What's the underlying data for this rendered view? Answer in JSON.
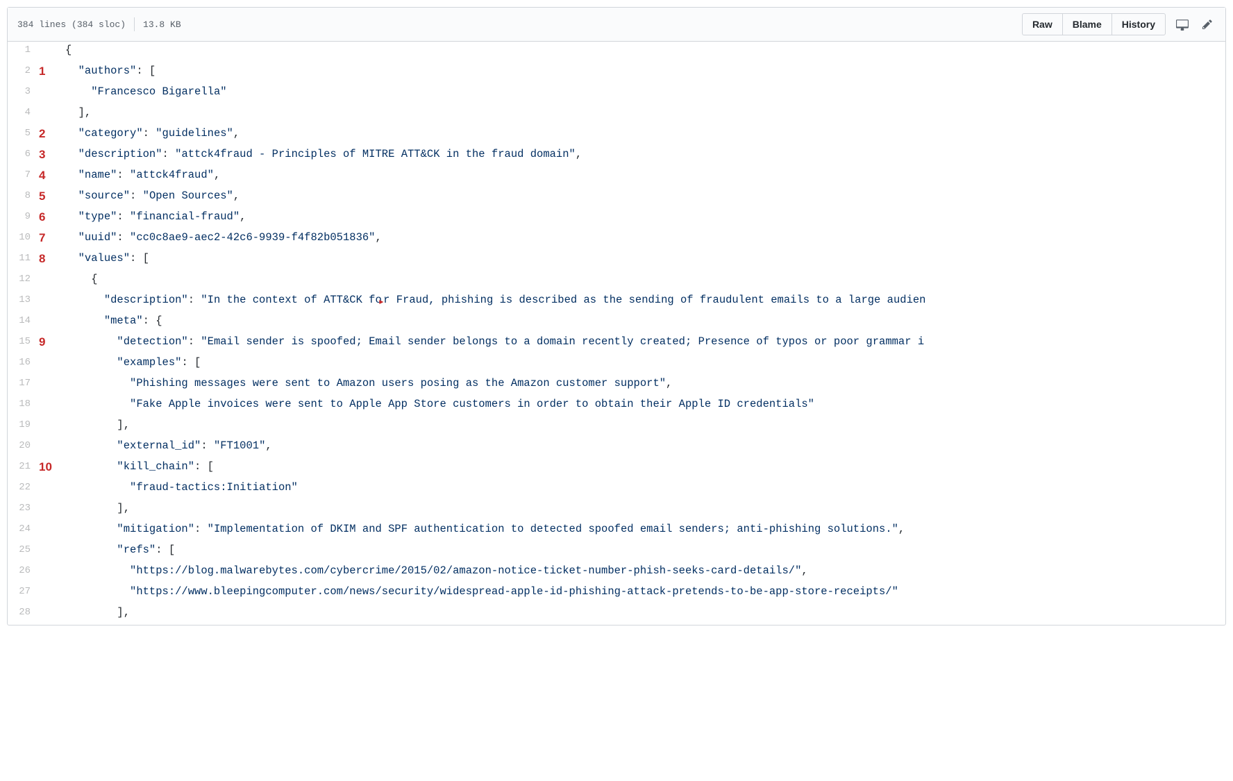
{
  "header": {
    "lines_text": "384 lines (384 sloc)",
    "size_text": "13.8 KB",
    "buttons": {
      "raw": "Raw",
      "blame": "Blame",
      "history": "History"
    }
  },
  "annotations": {
    "2": "1",
    "5": "2",
    "6": "3",
    "7": "4",
    "8": "5",
    "9": "6",
    "10": "7",
    "11": "8",
    "15": "9",
    "21": "10"
  },
  "code_lines": [
    {
      "n": 1,
      "indent": 0,
      "segs": [
        {
          "t": "{",
          "c": "p"
        }
      ]
    },
    {
      "n": 2,
      "indent": 2,
      "segs": [
        {
          "t": "\"authors\"",
          "c": "s"
        },
        {
          "t": ": [",
          "c": "p"
        }
      ]
    },
    {
      "n": 3,
      "indent": 4,
      "segs": [
        {
          "t": "\"Francesco Bigarella\"",
          "c": "s"
        }
      ]
    },
    {
      "n": 4,
      "indent": 2,
      "segs": [
        {
          "t": "],",
          "c": "p"
        }
      ]
    },
    {
      "n": 5,
      "indent": 2,
      "segs": [
        {
          "t": "\"category\"",
          "c": "s"
        },
        {
          "t": ": ",
          "c": "p"
        },
        {
          "t": "\"guidelines\"",
          "c": "s"
        },
        {
          "t": ",",
          "c": "p"
        }
      ]
    },
    {
      "n": 6,
      "indent": 2,
      "segs": [
        {
          "t": "\"description\"",
          "c": "s"
        },
        {
          "t": ": ",
          "c": "p"
        },
        {
          "t": "\"attck4fraud - Principles of MITRE ATT&CK in the fraud domain\"",
          "c": "s"
        },
        {
          "t": ",",
          "c": "p"
        }
      ]
    },
    {
      "n": 7,
      "indent": 2,
      "segs": [
        {
          "t": "\"name\"",
          "c": "s"
        },
        {
          "t": ": ",
          "c": "p"
        },
        {
          "t": "\"attck4fraud\"",
          "c": "s"
        },
        {
          "t": ",",
          "c": "p"
        }
      ]
    },
    {
      "n": 8,
      "indent": 2,
      "segs": [
        {
          "t": "\"source\"",
          "c": "s"
        },
        {
          "t": ": ",
          "c": "p"
        },
        {
          "t": "\"Open Sources\"",
          "c": "s"
        },
        {
          "t": ",",
          "c": "p"
        }
      ]
    },
    {
      "n": 9,
      "indent": 2,
      "segs": [
        {
          "t": "\"type\"",
          "c": "s"
        },
        {
          "t": ": ",
          "c": "p"
        },
        {
          "t": "\"financial-fraud\"",
          "c": "s"
        },
        {
          "t": ",",
          "c": "p"
        }
      ]
    },
    {
      "n": 10,
      "indent": 2,
      "segs": [
        {
          "t": "\"uuid\"",
          "c": "s"
        },
        {
          "t": ": ",
          "c": "p"
        },
        {
          "t": "\"cc0c8ae9-aec2-42c6-9939-f4f82b051836\"",
          "c": "s"
        },
        {
          "t": ",",
          "c": "p"
        }
      ]
    },
    {
      "n": 11,
      "indent": 2,
      "segs": [
        {
          "t": "\"values\"",
          "c": "s"
        },
        {
          "t": ": [",
          "c": "p"
        }
      ]
    },
    {
      "n": 12,
      "indent": 4,
      "segs": [
        {
          "t": "{",
          "c": "p"
        }
      ]
    },
    {
      "n": 13,
      "indent": 6,
      "segs": [
        {
          "t": "\"description\"",
          "c": "s"
        },
        {
          "t": ": ",
          "c": "p"
        },
        {
          "t": "\"In the context of ATT&CK fo",
          "c": "s"
        },
        {
          "t": "▸",
          "c": "cur"
        },
        {
          "t": "r Fraud, phishing is described as the sending of fraudulent emails to a large audien",
          "c": "s"
        }
      ]
    },
    {
      "n": 14,
      "indent": 6,
      "segs": [
        {
          "t": "\"meta\"",
          "c": "s"
        },
        {
          "t": ": {",
          "c": "p"
        }
      ]
    },
    {
      "n": 15,
      "indent": 8,
      "segs": [
        {
          "t": "\"detection\"",
          "c": "s"
        },
        {
          "t": ": ",
          "c": "p"
        },
        {
          "t": "\"Email sender is spoofed; Email sender belongs to a domain recently created; Presence of typos or poor grammar i",
          "c": "s"
        }
      ]
    },
    {
      "n": 16,
      "indent": 8,
      "segs": [
        {
          "t": "\"examples\"",
          "c": "s"
        },
        {
          "t": ": [",
          "c": "p"
        }
      ]
    },
    {
      "n": 17,
      "indent": 10,
      "segs": [
        {
          "t": "\"Phishing messages were sent to Amazon users posing as the Amazon customer support\"",
          "c": "s"
        },
        {
          "t": ",",
          "c": "p"
        }
      ]
    },
    {
      "n": 18,
      "indent": 10,
      "segs": [
        {
          "t": "\"Fake Apple invoices were sent to Apple App Store customers in order to obtain their Apple ID credentials\"",
          "c": "s"
        }
      ]
    },
    {
      "n": 19,
      "indent": 8,
      "segs": [
        {
          "t": "],",
          "c": "p"
        }
      ]
    },
    {
      "n": 20,
      "indent": 8,
      "segs": [
        {
          "t": "\"external_id\"",
          "c": "s"
        },
        {
          "t": ": ",
          "c": "p"
        },
        {
          "t": "\"FT1001\"",
          "c": "s"
        },
        {
          "t": ",",
          "c": "p"
        }
      ]
    },
    {
      "n": 21,
      "indent": 8,
      "segs": [
        {
          "t": "\"kill_chain\"",
          "c": "s"
        },
        {
          "t": ": [",
          "c": "p"
        }
      ]
    },
    {
      "n": 22,
      "indent": 10,
      "segs": [
        {
          "t": "\"fraud-tactics:Initiation\"",
          "c": "s"
        }
      ]
    },
    {
      "n": 23,
      "indent": 8,
      "segs": [
        {
          "t": "],",
          "c": "p"
        }
      ]
    },
    {
      "n": 24,
      "indent": 8,
      "segs": [
        {
          "t": "\"mitigation\"",
          "c": "s"
        },
        {
          "t": ": ",
          "c": "p"
        },
        {
          "t": "\"Implementation of DKIM and SPF authentication to detected spoofed email senders; anti-phishing solutions.\"",
          "c": "s"
        },
        {
          "t": ",",
          "c": "p"
        }
      ]
    },
    {
      "n": 25,
      "indent": 8,
      "segs": [
        {
          "t": "\"refs\"",
          "c": "s"
        },
        {
          "t": ": [",
          "c": "p"
        }
      ]
    },
    {
      "n": 26,
      "indent": 10,
      "segs": [
        {
          "t": "\"https://blog.malwarebytes.com/cybercrime/2015/02/amazon-notice-ticket-number-phish-seeks-card-details/\"",
          "c": "s"
        },
        {
          "t": ",",
          "c": "p"
        }
      ]
    },
    {
      "n": 27,
      "indent": 10,
      "segs": [
        {
          "t": "\"https://www.bleepingcomputer.com/news/security/widespread-apple-id-phishing-attack-pretends-to-be-app-store-receipts/\"",
          "c": "s"
        }
      ]
    },
    {
      "n": 28,
      "indent": 8,
      "segs": [
        {
          "t": "],",
          "c": "p"
        }
      ]
    }
  ]
}
